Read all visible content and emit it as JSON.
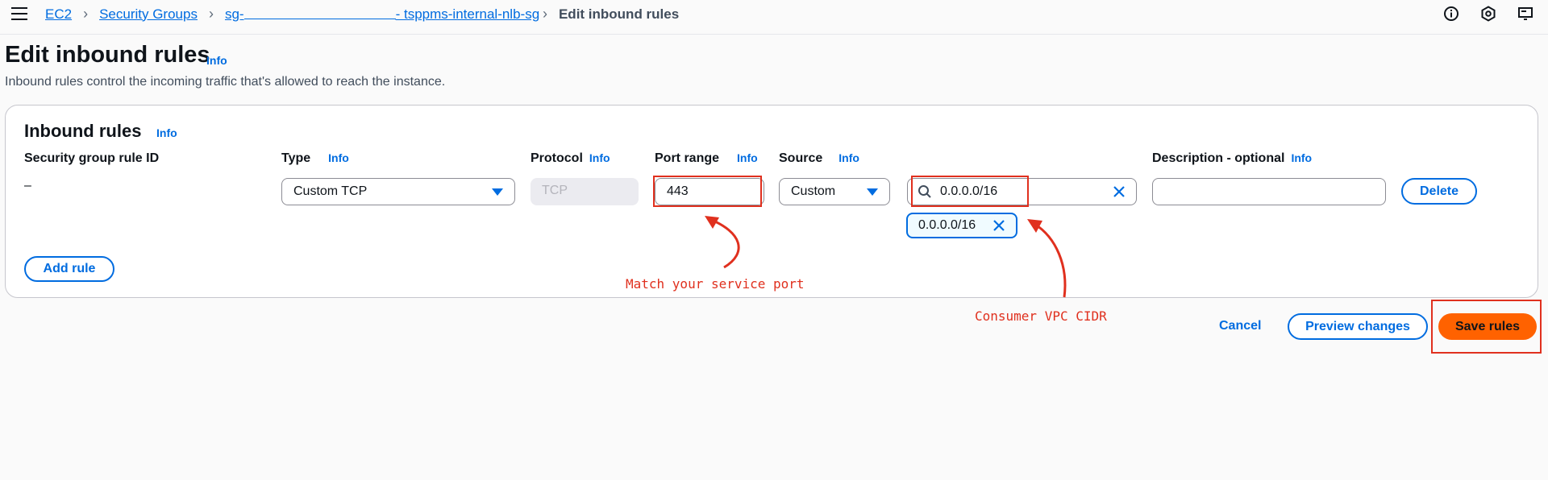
{
  "breadcrumb": {
    "items": [
      "EC2",
      "Security Groups"
    ],
    "sg_prefix": "sg-",
    "sg_suffix": "- tsppms-internal-nlb-sg",
    "current": "Edit inbound rules"
  },
  "page": {
    "title": "Edit inbound rules",
    "info": "Info",
    "description": "Inbound rules control the incoming traffic that's allowed to reach the instance."
  },
  "panel": {
    "title": "Inbound rules",
    "info": "Info",
    "columns": {
      "rule_id": "Security group rule ID",
      "type": "Type",
      "protocol": "Protocol",
      "port_range": "Port range",
      "source": "Source",
      "description": "Description - optional",
      "info": "Info"
    },
    "row": {
      "rule_id": "–",
      "type": "Custom TCP",
      "protocol": "TCP",
      "port_range": "443",
      "source": "Custom",
      "cidr_search": "0.0.0.0/16",
      "cidr_token": "0.0.0.0/16",
      "description": "",
      "delete": "Delete"
    },
    "add_rule": "Add rule"
  },
  "footer": {
    "cancel": "Cancel",
    "preview": "Preview changes",
    "save": "Save rules"
  },
  "annotations": {
    "port": "Match your service port",
    "cidr": "Consumer VPC CIDR"
  },
  "colors": {
    "accent": "#006ce0",
    "primary_button": "#ff6200",
    "annotation": "#e0301e"
  }
}
